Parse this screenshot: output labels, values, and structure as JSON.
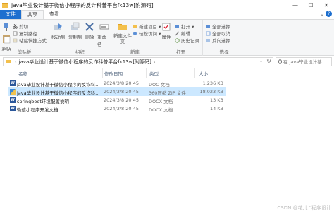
{
  "window": {
    "title": "java毕业设计基于微信小程序的反诈科普平台fk13w[附源码]",
    "minimize": "—",
    "maximize": "☐",
    "close": "✕"
  },
  "ribbon_tabs": [
    {
      "label": "文件"
    },
    {
      "label": "共享"
    },
    {
      "label": "查看"
    }
  ],
  "ribbon": {
    "clipboard": {
      "label": "剪贴板",
      "pin": "固定到快速访问",
      "copy": "复制",
      "paste": "粘贴",
      "cut": "剪切",
      "copy_path": "复制路径",
      "paste_shortcut": "粘贴快捷方式"
    },
    "organize": {
      "label": "组织",
      "move_to": "移动到",
      "copy_to": "复制到",
      "delete": "删除",
      "rename": "重命名"
    },
    "new": {
      "label": "新建",
      "new_folder": "新建文件夹",
      "new_item": "新建项目 ▾",
      "easy_access": "轻松访问 ▾"
    },
    "open": {
      "label": "打开",
      "properties": "属性",
      "open": "打开 ▾",
      "edit": "编辑",
      "history": "历史记录"
    },
    "select": {
      "label": "选择",
      "select_all": "全部选择",
      "select_none": "全部取消",
      "invert": "反向选择"
    }
  },
  "address": {
    "crumbs": [
      "java毕业设计基于微信小程序的反诈科普平台fk13w[附源码]"
    ],
    "search_placeholder": "在 java毕业设计基..."
  },
  "columns": {
    "name": "名称",
    "date": "修改日期",
    "type": "类型",
    "size": "大小"
  },
  "files": [
    {
      "name": "java毕业设计基于微信小程序的反诈科普...",
      "date": "2024/3/8 20:45",
      "type": "DOC 文档",
      "size": "1,236 KB",
      "icon": "word-icon"
    },
    {
      "name": "java毕业设计基于微信小程序的反诈科普...",
      "date": "2024/3/8 20:45",
      "type": "360压缩 ZIP 文件",
      "size": "18,023 KB",
      "icon": "zip-icon"
    },
    {
      "name": "springboot环境配置说明",
      "date": "2024/3/8 20:45",
      "type": "DOCX 文档",
      "size": "13 KB",
      "icon": "word-icon"
    },
    {
      "name": "微信小程序开发文档",
      "date": "2024/3/8 20:45",
      "type": "DOCX 文档",
      "size": "14 KB",
      "icon": "word-icon"
    }
  ],
  "watermark": "CSDN @花儿 \"程序设计"
}
